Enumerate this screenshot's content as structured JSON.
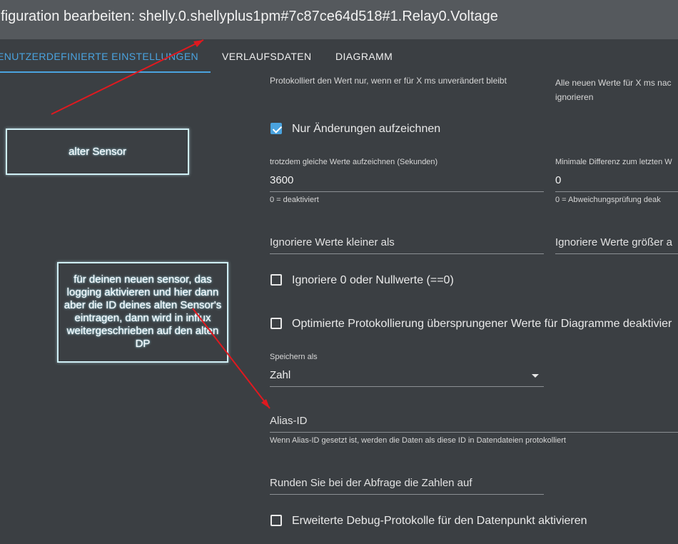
{
  "dialog": {
    "title": "nfiguration bearbeiten: shelly.0.shellyplus1pm#7c87ce64d518#1.Relay0.Voltage"
  },
  "tabs": [
    {
      "label": "ENUTZERDEFINIERTE EINSTELLUNGEN",
      "active": true
    },
    {
      "label": "VERLAUFSDATEN"
    },
    {
      "label": "DIAGRAMM"
    }
  ],
  "settings": {
    "debounce_desc": "Protokolliert den Wert nur, wenn er für X ms unverändert bleibt",
    "ignore_desc": "Alle neuen Werte für X ms nac ignorieren",
    "only_changes_label": "Nur Änderungen aufzeichnen",
    "only_changes_checked": true,
    "same_values_label": "trotzdem gleiche Werte aufzeichnen (Sekunden)",
    "same_values_value": "3600",
    "same_values_helper": "0 = deaktiviert",
    "min_diff_label": "Minimale Differenz zum letzten W",
    "min_diff_value": "0",
    "min_diff_helper": "0 = Abweichungsprüfung deak",
    "ignore_below_placeholder": "Ignoriere Werte kleiner als",
    "ignore_above_placeholder": "Ignoriere Werte größer a",
    "ignore_zero_label": "Ignoriere 0 oder Nullwerte (==0)",
    "ignore_zero_checked": false,
    "optimized_label": "Optimierte Protokollierung übersprungener Werte für Diagramme deaktivier",
    "optimized_checked": false,
    "store_as_label": "Speichern als",
    "store_as_value": "Zahl",
    "alias_placeholder": "Alias-ID",
    "alias_helper": "Wenn Alias-ID gesetzt ist, werden die Daten als diese ID in Datendateien protokolliert",
    "round_placeholder": "Runden Sie bei der Abfrage die Zahlen auf",
    "debug_label": "Erweiterte Debug-Protokolle für den Datenpunkt aktivieren",
    "debug_checked": false
  },
  "annotations": {
    "old_sensor": "alter Sensor",
    "new_sensor_note": "für deinen neuen sensor, das logging aktivieren und hier dann aber die ID deines alten Sensor's eintragen, dann wird in influx weitergeschrieben auf den alten DP"
  },
  "colors": {
    "accent": "#4aa3df",
    "annotation_arrow": "#e0191f",
    "background": "#3b3f43",
    "titlebar": "#55595d"
  }
}
